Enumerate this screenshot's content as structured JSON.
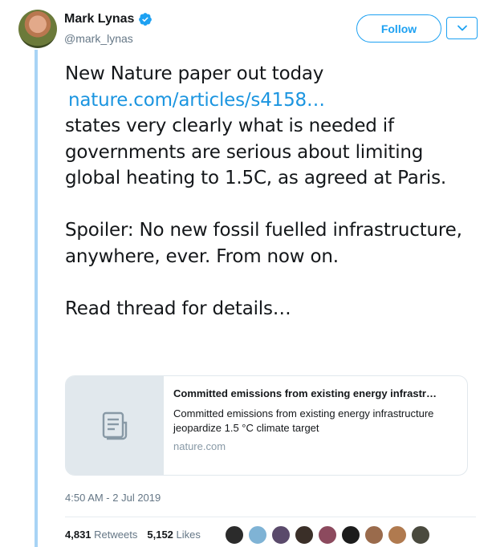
{
  "author": {
    "name": "Mark Lynas",
    "handle": "@mark_lynas"
  },
  "actions": {
    "follow_label": "Follow"
  },
  "tweet": {
    "line1": "New Nature paper out today",
    "link": "nature.com/articles/s4158…",
    "body1": "states very clearly what is needed if governments are serious about limiting global heating to 1.5C, as agreed at Paris.",
    "body2": "Spoiler: No new fossil fuelled infrastructure, anywhere, ever. From now on.",
    "body3": "Read thread for details…"
  },
  "card": {
    "title": "Committed emissions from existing energy infrastr…",
    "description": "Committed emissions from existing energy infrastructure jeopardize 1.5 °C climate target",
    "domain": "nature.com"
  },
  "timestamp": "4:50 AM - 2 Jul 2019",
  "stats": {
    "retweets_count": "4,831",
    "retweets_label": "Retweets",
    "likes_count": "5,152",
    "likes_label": "Likes"
  },
  "colors": {
    "accent": "#1da1f2",
    "link": "#1b95e0",
    "thread_line": "#a8d4f5"
  },
  "likers": [
    {
      "color": "#2b2b2b"
    },
    {
      "color": "#7fb3d5"
    },
    {
      "color": "#5a4a6b"
    },
    {
      "color": "#3a2f28"
    },
    {
      "color": "#8c4a5e"
    },
    {
      "color": "#1c1c1c"
    },
    {
      "color": "#9a6b4c"
    },
    {
      "color": "#b07a4f"
    },
    {
      "color": "#4a4a3e"
    }
  ]
}
